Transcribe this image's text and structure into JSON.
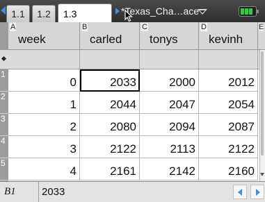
{
  "tabs": [
    {
      "label": "1.1"
    },
    {
      "label": "1.2"
    },
    {
      "label": "1.3",
      "active": true
    }
  ],
  "document": {
    "title": "*Texas_Cha…ace"
  },
  "icons": {
    "prev_page": "left-triangle-icon",
    "next_page": "right-triangle-icon",
    "doc_menu": "dropdown-triangle-icon",
    "battery": "battery-icon",
    "cursor": "mouse-pointer-icon",
    "row_marker": "diamond-icon"
  },
  "colors": {
    "accent": "#3d8fe0",
    "battery": "#2ecc40",
    "header_bg": "#d6d6d6",
    "formula_bg": "#dcdcdc"
  },
  "spreadsheet": {
    "columns": [
      {
        "letter": "A",
        "name": "week"
      },
      {
        "letter": "B",
        "name": "carled"
      },
      {
        "letter": "C",
        "name": "tonys"
      },
      {
        "letter": "D",
        "name": "kevinh"
      },
      {
        "letter": "E",
        "name": ""
      }
    ],
    "formula_row_marker": "◆",
    "row_numbers": [
      "1",
      "2",
      "3",
      "4",
      "5"
    ],
    "rows": [
      [
        "0",
        "2033",
        "2000",
        "2012"
      ],
      [
        "1",
        "2044",
        "2047",
        "2054"
      ],
      [
        "2",
        "2080",
        "2094",
        "2087"
      ],
      [
        "3",
        "2122",
        "2113",
        "2122"
      ],
      [
        "4",
        "2161",
        "2142",
        "2160"
      ]
    ],
    "selected": {
      "row": 0,
      "col": 1
    }
  },
  "status_bar": {
    "cell_ref": "B1",
    "cell_value": "2033"
  }
}
